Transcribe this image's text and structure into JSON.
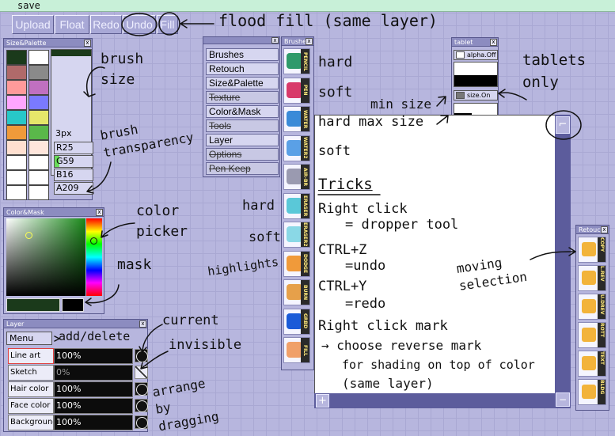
{
  "toolbar": {
    "buttons": [
      "Upload",
      "Float",
      "Redo",
      "Undo",
      "Fill"
    ]
  },
  "size_palette": {
    "title": "Size&Palette",
    "swatch_colors": [
      "#1b3a1b",
      "#ffffff",
      "#b06a6a",
      "#8a8a8a",
      "#ff9a9a",
      "#c070c0",
      "#ffa6ff",
      "#7a7aff",
      "#28c8c8",
      "#e6e66a",
      "#f09a3a",
      "#5ab84a",
      "#ffe0d0",
      "#ffe6dc",
      "#ffffff",
      "#ffffff",
      "#ffffff",
      "#ffffff",
      "#ffffff",
      "#ffffff"
    ],
    "size": "3px",
    "r": "R25",
    "g": "G59",
    "b": "B16",
    "a": "A209",
    "current_color": "#1b3a1b"
  },
  "color_mask": {
    "title": "Color&Mask"
  },
  "menu_panel": {
    "items": [
      {
        "label": "Brushes",
        "enabled": true
      },
      {
        "label": "Retouch",
        "enabled": true
      },
      {
        "label": "Size&Palette",
        "enabled": true
      },
      {
        "label": "Texture",
        "enabled": false
      },
      {
        "label": "Color&Mask",
        "enabled": true
      },
      {
        "label": "Tools",
        "enabled": false
      },
      {
        "label": "Layer",
        "enabled": true
      },
      {
        "label": "Options",
        "enabled": false
      },
      {
        "label": "Pen Keep",
        "enabled": false
      }
    ]
  },
  "brushes": {
    "title": "Brushes",
    "items": [
      {
        "label": "PENCIL",
        "color": "#2f9a6a"
      },
      {
        "label": "PEN",
        "color": "#d83a6a"
      },
      {
        "label": "WATER",
        "color": "#3a8ad8"
      },
      {
        "label": "WATER2",
        "color": "#5aa0e6"
      },
      {
        "label": "AIR-BR",
        "color": "#9a9ab0"
      },
      {
        "label": "ERASER",
        "color": "#5ac8d8"
      },
      {
        "label": "ERASER2",
        "color": "#8ad8e6"
      },
      {
        "label": "DODGE",
        "color": "#f09a3a"
      },
      {
        "label": "BURN",
        "color": "#e6a04a"
      },
      {
        "label": "GRBD",
        "color": "#1a5ad8"
      },
      {
        "label": "FILL",
        "color": "#f0a06a"
      }
    ]
  },
  "tablet": {
    "title": "tablet",
    "alpha_label": "alpha.Off",
    "size_label": "size.On"
  },
  "layer": {
    "title": "Layer",
    "menu_label": "Menu",
    "rows": [
      {
        "name": "Line art",
        "opacity": "100%"
      },
      {
        "name": "Sketch",
        "opacity": "0%"
      },
      {
        "name": "Hair color",
        "opacity": "100%"
      },
      {
        "name": "Face color",
        "opacity": "100%"
      },
      {
        "name": "Background",
        "opacity": "100%"
      }
    ]
  },
  "retouch": {
    "title": "Retouc",
    "items": [
      {
        "label": "COPY"
      },
      {
        "label": "L.REV"
      },
      {
        "label": "U.DREV"
      },
      {
        "label": "ROTT"
      },
      {
        "label": "TEXT"
      },
      {
        "label": "BLDG"
      }
    ]
  },
  "canvas": {
    "plus": "+",
    "minus": "−",
    "corner_icon": "⌐"
  },
  "annotations": {
    "save": "save",
    "flood_fill": "flood fill (same layer)",
    "brush_size": "brush size",
    "brush_transparency": "brush transparency",
    "color_picker": "color picker",
    "mask": "mask",
    "add_delete": "add/delete",
    "current": "current",
    "invisible": "invisible",
    "arrange": "arrange by dragging",
    "hard1": "hard",
    "soft1": "soft",
    "min_size": "min size",
    "hard_max_size": "hard max size",
    "soft2": "soft",
    "hard2": "hard",
    "soft3": "soft",
    "highlights": "highlights",
    "tablets_only": "tablets only",
    "moving_selection": "moving selection",
    "tricks": "Tricks",
    "trick1a": "Right click",
    "trick1b": "= dropper tool",
    "trick2a": "CTRL+Z",
    "trick2b": "=undo",
    "trick3a": "CTRL+Y",
    "trick3b": "=redo",
    "trick4a": "Right click mark",
    "trick4b": "→ choose reverse mark",
    "trick4c": "for shading on top of color",
    "trick4d": "(same layer)"
  }
}
